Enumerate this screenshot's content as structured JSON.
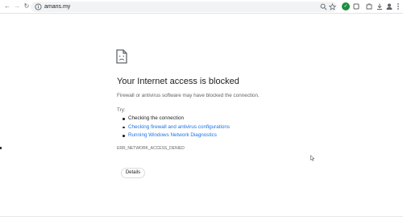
{
  "browser": {
    "url": "amans.my",
    "nav": {
      "back": "←",
      "forward": "→",
      "reload": "↻"
    }
  },
  "page": {
    "title": "Your Internet access is blocked",
    "subtitle": "Firewall or antivirus software may have blocked the connection.",
    "try_label": "Try:",
    "suggestions": [
      {
        "text": "Checking the connection",
        "link": false
      },
      {
        "text": "Checking firewall and antivirus configurations",
        "link": true
      },
      {
        "text": "Running Windows Network Diagnostics",
        "link": true
      }
    ],
    "error_code": "ERR_NETWORK_ACCESS_DENIED",
    "details_label": "Details"
  },
  "icons": {
    "page_icon": "sad-document-icon",
    "lock": "site-info-icon",
    "search": "search-icon",
    "bookmark": "star-icon"
  },
  "colors": {
    "link": "#1a73e8",
    "text": "#202124",
    "muted": "#5f6368",
    "extension_green": "#1e8e3e"
  }
}
